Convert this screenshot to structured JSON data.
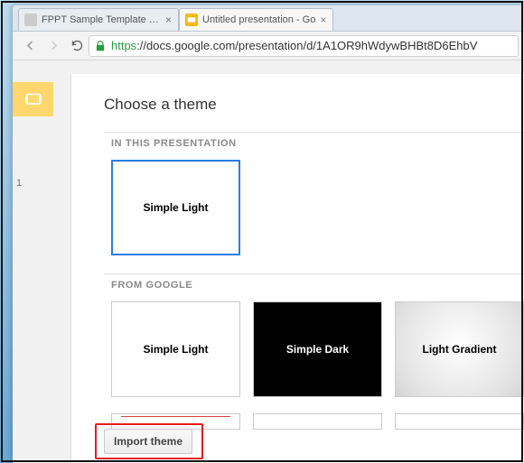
{
  "browser": {
    "tabs": [
      {
        "title": "FPPT Sample Template - G",
        "active": false
      },
      {
        "title": "Untitled presentation - Go",
        "active": true
      }
    ],
    "url_scheme": "https",
    "url_host_path": "://docs.google.com/presentation/d/1A1OR9hWdywBHBt8D6EhbV"
  },
  "filmstrip": {
    "slide_number": "1"
  },
  "dialog": {
    "title": "Choose a theme",
    "sections": {
      "in_presentation": {
        "label": "IN THIS PRESENTATION"
      },
      "from_google": {
        "label": "FROM GOOGLE"
      }
    },
    "themes": {
      "selected": "Simple Light",
      "google": [
        "Simple Light",
        "Simple Dark",
        "Light Gradient"
      ]
    },
    "import_button": "Import theme"
  }
}
